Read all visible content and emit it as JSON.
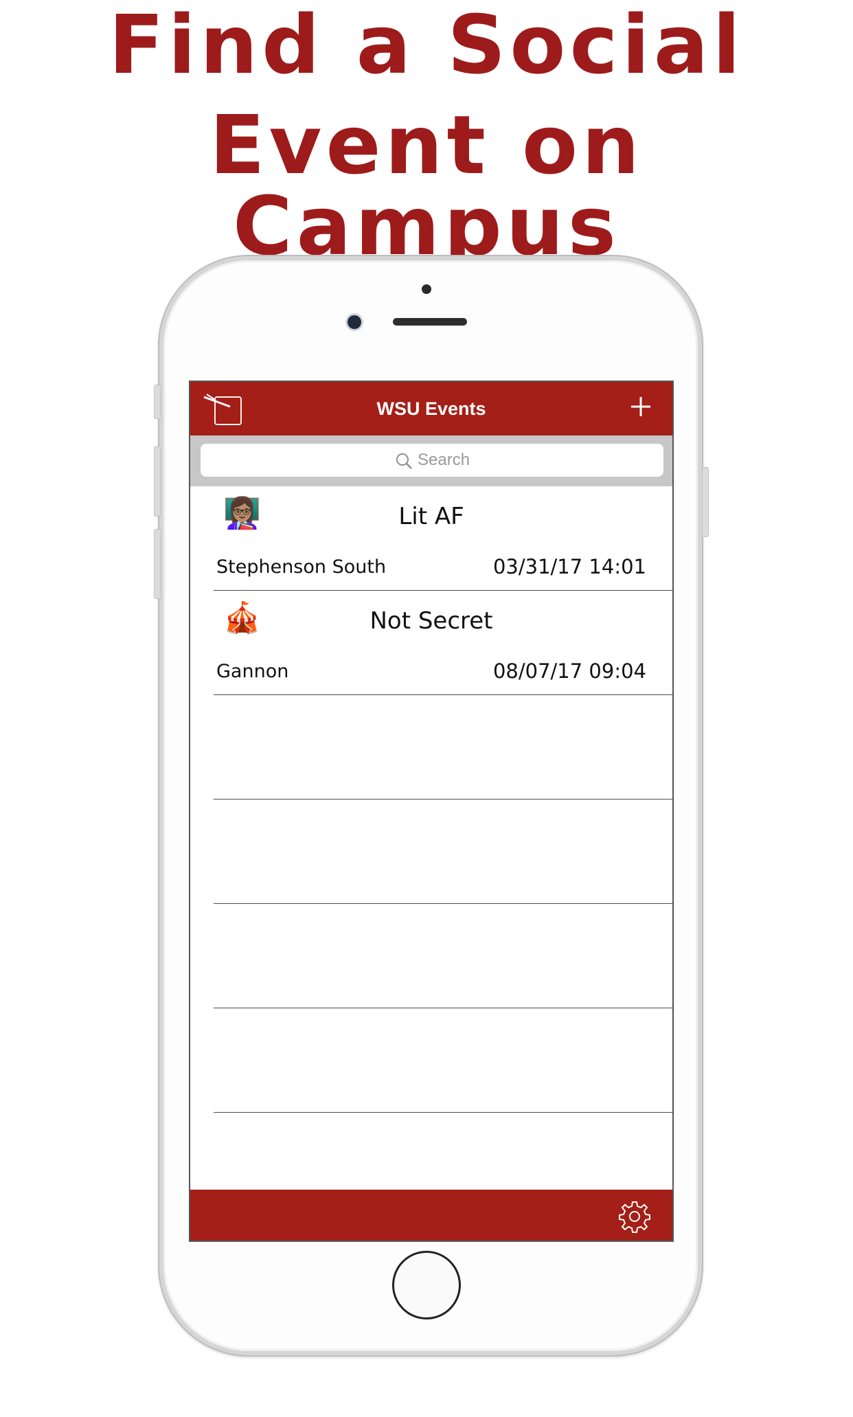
{
  "headline": {
    "line1": "Find a Social",
    "line2": "Event on Campus"
  },
  "app": {
    "title": "WSU Events"
  },
  "search": {
    "placeholder": "Search"
  },
  "events": [
    {
      "emoji": "👩🏽‍🏫",
      "title": "Lit AF",
      "location": "Stephenson South",
      "datetime": "03/31/17 14:01"
    },
    {
      "emoji": "🎪",
      "title": "Not Secret",
      "location": "Gannon",
      "datetime": "08/07/17 09:04"
    },
    {
      "emoji": "",
      "title": "",
      "location": "",
      "datetime": ""
    },
    {
      "emoji": "",
      "title": "",
      "location": "",
      "datetime": ""
    },
    {
      "emoji": "",
      "title": "",
      "location": "",
      "datetime": ""
    },
    {
      "emoji": "",
      "title": "",
      "location": "",
      "datetime": ""
    },
    {
      "emoji": "",
      "title": "",
      "location": "",
      "datetime": ""
    }
  ],
  "icons": {
    "menu": "menu-icon",
    "add": "plus-icon",
    "search": "search-icon",
    "settings": "gear-icon"
  },
  "colors": {
    "brand": "#a31f17",
    "headline": "#9e1b1b",
    "searchbar_bg": "#c7c7c7"
  }
}
